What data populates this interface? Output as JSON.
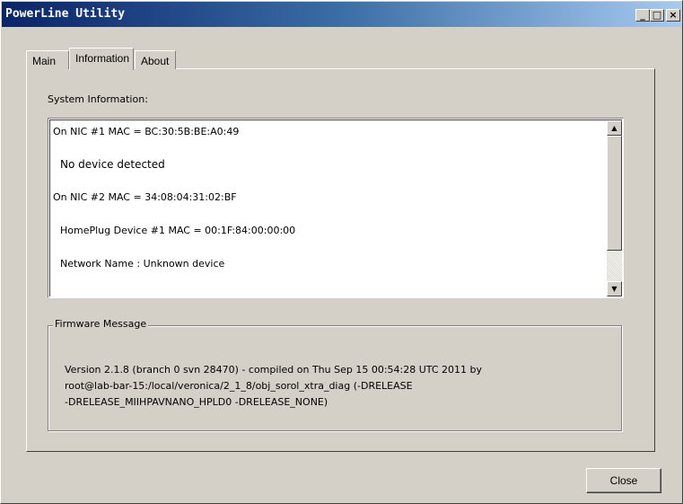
{
  "window": {
    "title": "PowerLine Utility",
    "minimize_glyph": "_",
    "maximize_glyph": "□",
    "close_glyph": "×"
  },
  "tabs": [
    {
      "label": "Main",
      "active": false
    },
    {
      "label": "Information",
      "active": true
    },
    {
      "label": "About",
      "active": false
    }
  ],
  "system_info": {
    "label": "System Information:",
    "lines": [
      "On NIC #1 MAC = BC:30:5B:BE:A0:49",
      "No device detected",
      "On NIC #2 MAC = 34:08:04:31:02:BF",
      "HomePlug Device #1 MAC = 00:1F:84:00:00:00",
      "Network Name : Unknown device"
    ]
  },
  "firmware": {
    "legend": "Firmware Message",
    "lines": [
      "Version 2.1.8 (branch 0 svn 28470) - compiled on Thu Sep 15 00:54:28 UTC 2011 by",
      "root@lab-bar-15:/local/veronica/2_1_8/obj_sorol_xtra_diag (-DRELEASE",
      "-DRELEASE_MIIHPAVNANO_HPLD0  -DRELEASE_NONE)"
    ]
  },
  "buttons": {
    "close_label": "Close"
  },
  "colors": {
    "titlebar_start": "#0a246a",
    "titlebar_end": "#a6caf0",
    "face": "#d4d0c8"
  }
}
